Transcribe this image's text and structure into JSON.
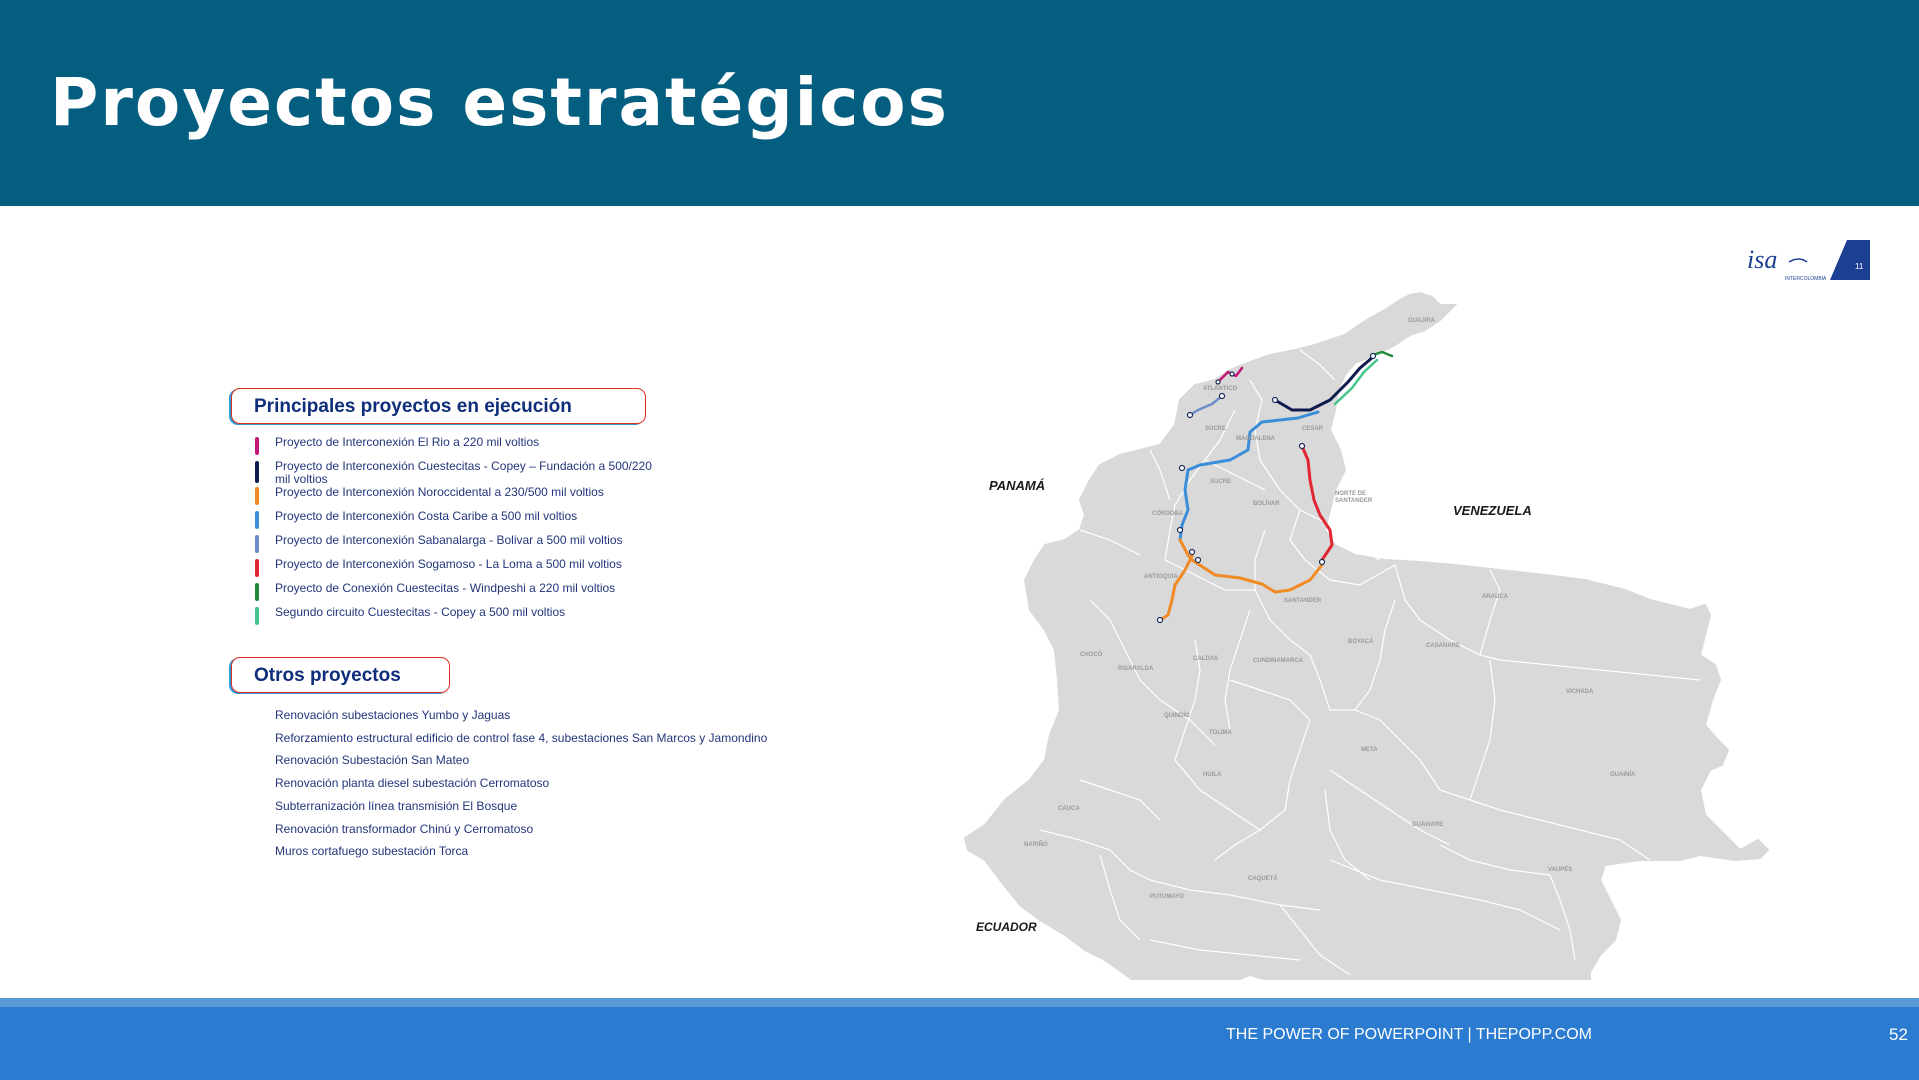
{
  "title": "Proyectos estratégicos",
  "main_projects": {
    "heading": "Principales proyectos en ejecución",
    "items": [
      {
        "label": "Proyecto de Interconexión El Rio a 220 mil voltios",
        "color": "#c2187a"
      },
      {
        "label": "Proyecto de Interconexión Cuestecitas - Copey – Fundación a 500/220 mil voltios",
        "color": "#0f1b4d"
      },
      {
        "label": "Proyecto de Interconexión Noroccidental a 230/500 mil voltios",
        "color": "#f08a24"
      },
      {
        "label": "Proyecto de Interconexión Costa Caribe a 500 mil voltios",
        "color": "#3a8dd8"
      },
      {
        "label": "Proyecto de Interconexión Sabanalarga - Bolivar a 500 mil voltios",
        "color": "#6b8cc9"
      },
      {
        "label": "Proyecto de Interconexión Sogamoso - La Loma a 500 mil voltios",
        "color": "#e02633"
      },
      {
        "label": "Proyecto de Conexión Cuestecitas - Windpeshi a 220 mil voltios",
        "color": "#1f8a3a"
      },
      {
        "label": "Segundo circuito Cuestecitas - Copey a 500 mil voltios",
        "color": "#43c48a"
      }
    ]
  },
  "other_projects": {
    "heading": "Otros proyectos",
    "items": [
      "Renovación subestaciones Yumbo y Jaguas",
      "Reforzamiento estructural edificio de control fase 4, subestaciones San Marcos y Jamondino",
      "Renovación Subestación San Mateo",
      "Renovación planta diesel subestación Cerromatoso",
      "Subterranización línea transmisión El Bosque",
      "Renovación transformador Chinú y Cerromatoso",
      "Muros cortafuego subestación Torca"
    ]
  },
  "map": {
    "country_labels": {
      "panama": "PANAMÁ",
      "venezuela": "VENEZUELA",
      "ecuador": "ECUADOR"
    },
    "departments": [
      "GUAJIRA",
      "MAGDALENA",
      "CESAR",
      "SUCRE",
      "BOLÍVAR",
      "NORTE DE",
      "SANTANDER",
      "CÓRDOBA",
      "ANTIOQUIA",
      "SANTANDER",
      "ARAUCA",
      "BOYACÁ",
      "CASANARE",
      "CHOCÓ",
      "RISARALDA",
      "CALDAS",
      "CUNDINAMARCA",
      "VICHADA",
      "QUINDÍO",
      "TOLIMA",
      "META",
      "GUAINÍA",
      "HUILA",
      "CAUCA",
      "GUAVIARE",
      "NARIÑO",
      "VAUPÉS",
      "CAQUETÁ",
      "PUTUMAYO",
      "ATLÁNTICO",
      "SUCRE"
    ],
    "department_label_colors": {
      "default": "#9a9a9a"
    },
    "land_color": "#d9d9d9",
    "border_color": "#ffffff"
  },
  "logo": {
    "text": "isa",
    "sub": "INTERCOLOMBIA",
    "badge": "11",
    "color": "#1c3f94"
  },
  "footer": {
    "text": "THE POWER OF POWERPOINT | THEPOPP.COM",
    "page": "52"
  }
}
